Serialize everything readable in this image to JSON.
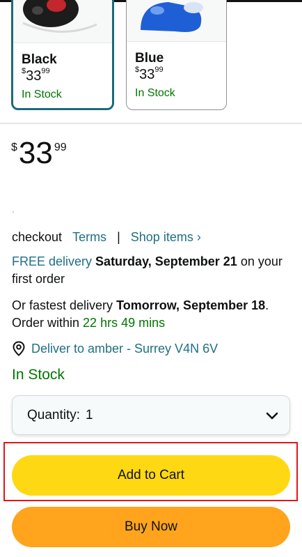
{
  "variants": [
    {
      "name": "Black",
      "price_symbol": "$",
      "price_whole": "33",
      "price_fraction": "99",
      "stock": "In Stock",
      "selected": true
    },
    {
      "name": "Blue",
      "price_symbol": "$",
      "price_whole": "33",
      "price_fraction": "99",
      "stock": "In Stock",
      "selected": false
    }
  ],
  "price": {
    "symbol": "$",
    "whole": "33",
    "fraction": "99"
  },
  "links_row": {
    "text": "checkout",
    "terms": "Terms",
    "separator": "|",
    "shop_items": "Shop items ›"
  },
  "delivery": {
    "free_label": "FREE delivery",
    "free_date": "Saturday, September 21",
    "free_suffix": "on your first order",
    "fastest_prefix": "Or fastest delivery",
    "fastest_date": "Tomorrow, September 18",
    "order_within": "Order within",
    "countdown": "22 hrs 49 mins"
  },
  "deliver_to": "Deliver to amber - Surrey V4N 6V",
  "stock_status": "In Stock",
  "quantity": {
    "label": "Quantity:",
    "value": "1"
  },
  "buttons": {
    "add_to_cart": "Add to Cart",
    "buy_now": "Buy Now"
  },
  "colors": {
    "add_to_cart": "#ffd814",
    "buy_now": "#ffa41c",
    "link": "#1f6f84",
    "in_stock": "#007600",
    "highlight": "#e0161b",
    "selected_border": "#1b6b7a"
  }
}
